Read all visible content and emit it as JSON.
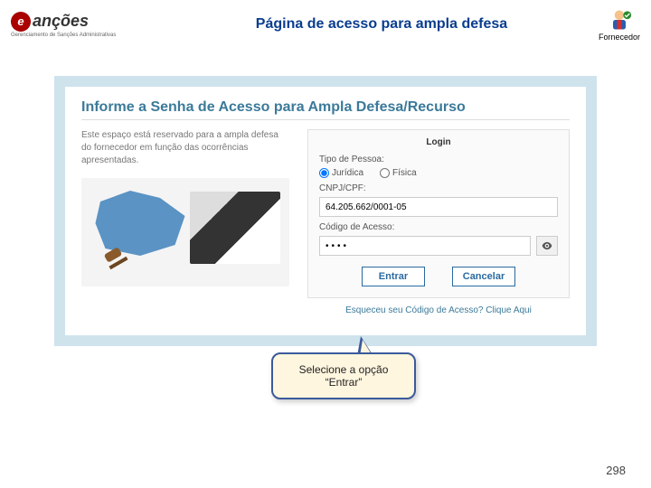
{
  "header": {
    "logo_main": "anções",
    "logo_prefix": "e",
    "logo_sub": "Gerenciamento de Sanções Administrativas",
    "title": "Página de acesso para ampla defesa",
    "supplier_label": "Fornecedor"
  },
  "panel": {
    "title": "Informe a Senha de Acesso para Ampla Defesa/Recurso",
    "description": "Este espaço está reservado para a ampla defesa do fornecedor em função das ocorrências apresentadas."
  },
  "login": {
    "heading": "Login",
    "person_type_label": "Tipo de Pessoa:",
    "radio_juridica": "Jurídica",
    "radio_fisica": "Física",
    "cnpj_label": "CNPJ/CPF:",
    "cnpj_value": "64.205.662/0001-05",
    "code_label": "Código de Acesso:",
    "code_value": "••••",
    "btn_enter": "Entrar",
    "btn_cancel": "Cancelar",
    "forgot": "Esqueceu seu Código de Acesso? Clique Aqui"
  },
  "callout": {
    "line1": "Selecione a opção",
    "line2": "“Entrar”"
  },
  "page_number": "298"
}
